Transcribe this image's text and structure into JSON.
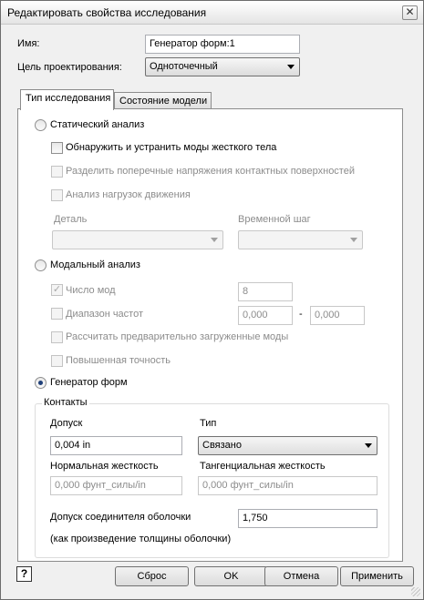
{
  "window": {
    "title": "Редактировать свойства исследования",
    "close_glyph": "✕"
  },
  "name_field": {
    "label": "Имя:",
    "value": "Генератор форм:1"
  },
  "design_goal": {
    "label": "Цель проектирования:",
    "value": "Одноточечный"
  },
  "tabs": [
    {
      "label": "Тип исследования",
      "active": true
    },
    {
      "label": "Состояние модели",
      "active": false
    }
  ],
  "static_analysis": {
    "label": "Статический анализ",
    "detect_rigid_modes": {
      "label": "Обнаружить и устранить моды жесткого тела",
      "checked": false
    },
    "separate_stresses": {
      "label": "Разделить поперечные напряжения контактных поверхностей",
      "checked": false
    },
    "motion_loads": {
      "label": "Анализ нагрузок движения",
      "checked": false
    },
    "part_label": "Деталь",
    "part_value": "",
    "time_step_label": "Временной шаг",
    "time_step_value": ""
  },
  "modal_analysis": {
    "label": "Модальный анализ",
    "num_modes": {
      "label": "Число мод",
      "checked": true,
      "value": "8"
    },
    "freq_range": {
      "label": "Диапазон частот",
      "checked": false,
      "from": "0,000",
      "separator": "-",
      "to": "0,000"
    },
    "preloaded_modes": {
      "label": "Рассчитать предварительно загруженные моды",
      "checked": false
    },
    "high_precision": {
      "label": "Повышенная точность",
      "checked": false
    }
  },
  "shape_generator": {
    "label": "Генератор форм",
    "selected": true
  },
  "contacts": {
    "title": "Контакты",
    "tolerance_label": "Допуск",
    "tolerance_value": "0,004 in",
    "type_label": "Тип",
    "type_value": "Связано",
    "normal_stiffness_label": "Нормальная жесткость",
    "normal_stiffness_placeholder": "0,000 фунт_силы/in",
    "tangential_stiffness_label": "Тангенциальная жесткость",
    "tangential_stiffness_placeholder": "0,000 фунт_силы/in",
    "shell_tolerance_label": "Допуск соединителя оболочки",
    "shell_tolerance_note": "(как произведение толщины оболочки)",
    "shell_tolerance_value": "1,750"
  },
  "footer": {
    "help_glyph": "?",
    "reset_label": "Сброс",
    "ok_label": "OK",
    "cancel_label": "Отмена",
    "apply_label": "Применить"
  }
}
